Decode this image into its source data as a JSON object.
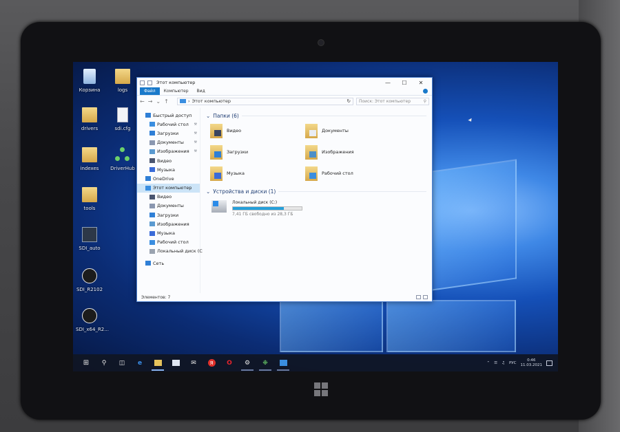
{
  "explorer": {
    "title": "Этот компьютер",
    "ribbon_tabs": [
      "Файл",
      "Компьютер",
      "Вид"
    ],
    "address": "Этот компьютер",
    "search_placeholder": "Поиск: Этот компьютер",
    "sidebar": [
      {
        "label": "Быстрый доступ",
        "icon": "star-icon",
        "level": 0,
        "pinned": false
      },
      {
        "label": "Рабочий стол",
        "icon": "desktop-icon",
        "level": 1,
        "pinned": true
      },
      {
        "label": "Загрузки",
        "icon": "download-icon",
        "level": 1,
        "pinned": true
      },
      {
        "label": "Документы",
        "icon": "documents-icon",
        "level": 1,
        "pinned": true
      },
      {
        "label": "Изображения",
        "icon": "pictures-icon",
        "level": 1,
        "pinned": true
      },
      {
        "label": "Видео",
        "icon": "video-icon",
        "level": 1,
        "pinned": false
      },
      {
        "label": "Музыка",
        "icon": "music-icon",
        "level": 1,
        "pinned": false
      },
      {
        "label": "OneDrive",
        "icon": "cloud-icon",
        "level": 0,
        "pinned": false
      },
      {
        "label": "Этот компьютер",
        "icon": "computer-icon",
        "level": 0,
        "pinned": false,
        "selected": true
      },
      {
        "label": "Видео",
        "icon": "video-icon",
        "level": 1,
        "pinned": false
      },
      {
        "label": "Документы",
        "icon": "documents-icon",
        "level": 1,
        "pinned": false
      },
      {
        "label": "Загрузки",
        "icon": "download-icon",
        "level": 1,
        "pinned": false
      },
      {
        "label": "Изображения",
        "icon": "pictures-icon",
        "level": 1,
        "pinned": false
      },
      {
        "label": "Музыка",
        "icon": "music-icon",
        "level": 1,
        "pinned": false
      },
      {
        "label": "Рабочий стол",
        "icon": "desktop-icon",
        "level": 1,
        "pinned": false
      },
      {
        "label": "Локальный диск (C",
        "icon": "drive-icon",
        "level": 1,
        "pinned": false
      },
      {
        "label": "Сеть",
        "icon": "network-icon",
        "level": 0,
        "pinned": false,
        "gap": true
      }
    ],
    "folders_header": "Папки (6)",
    "folders": [
      {
        "label": "Видео",
        "overlay": "film-icon"
      },
      {
        "label": "Документы",
        "overlay": "document-icon"
      },
      {
        "label": "Загрузки",
        "overlay": "download-arrow-icon"
      },
      {
        "label": "Изображения",
        "overlay": "picture-icon"
      },
      {
        "label": "Музыка",
        "overlay": "music-note-icon"
      },
      {
        "label": "Рабочий стол",
        "overlay": "desktop-icon"
      }
    ],
    "devices_header": "Устройства и диски (1)",
    "drive": {
      "label": "Локальный диск (C:)",
      "free_text": "7,41 ГБ свободно из 28,3 ГБ",
      "used_fraction": 0.74
    },
    "status": "Элементов: 7"
  },
  "desktop_icons": [
    {
      "label": "Корзина",
      "type": "bin"
    },
    {
      "label": "logs",
      "type": "folder"
    },
    {
      "label": "drivers",
      "type": "folder"
    },
    {
      "label": "sdi.cfg",
      "type": "file"
    },
    {
      "label": "indexes",
      "type": "folder"
    },
    {
      "label": "DriverHub",
      "type": "hub"
    },
    {
      "label": "tools",
      "type": "folder"
    },
    {
      "label": "SDI_auto",
      "type": "sdi"
    },
    {
      "label": "SDI_R2102",
      "type": "sdi-round"
    },
    {
      "label": "SDI_x64_R2...",
      "type": "sdi-round"
    }
  ],
  "tray": {
    "language": "РУС",
    "time": "0:46",
    "date": "11.03.2021"
  },
  "colors": {
    "accent": "#1979ca",
    "selection": "#cce4f7",
    "drive_bar": "#26a0da"
  }
}
